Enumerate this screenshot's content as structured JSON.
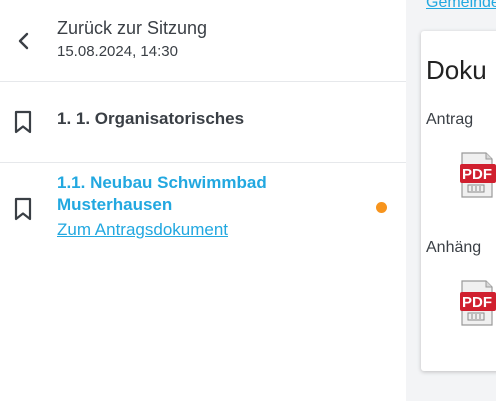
{
  "back": {
    "title": "Zurück zur Sitzung",
    "datetime": "15.08.2024, 14:30"
  },
  "agenda": {
    "items": [
      {
        "title": "1. 1. Organisatorisches"
      },
      {
        "title_line1": "1.1. Neubau Schwimmbad",
        "title_line2": "Musterhausen",
        "link": "Zum Antragsdokument",
        "status_color": "#f7941d"
      }
    ]
  },
  "right": {
    "top_link": "Gemeinde",
    "card_title": "Doku",
    "sections": [
      {
        "label": "Antrag",
        "file_icon": "pdf-icon"
      },
      {
        "label": "Anhäng",
        "file_icon": "pdf-icon"
      }
    ],
    "pdf_badge": "PDF"
  },
  "colors": {
    "accent": "#22a8e0",
    "text": "#3a3f45",
    "pdf_red": "#d0202f"
  }
}
